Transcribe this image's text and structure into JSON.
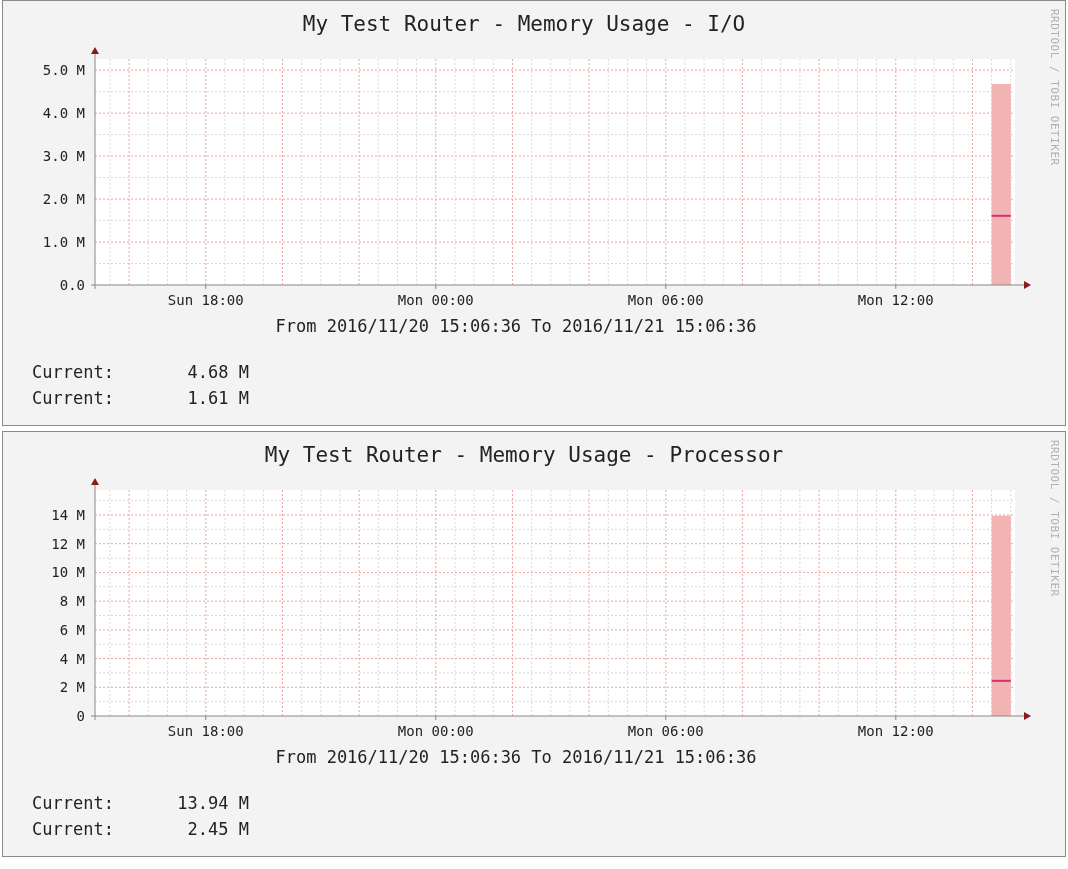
{
  "graphs": [
    {
      "title": "My Test Router - Memory Usage - I/O",
      "credit": "RRDTOOL / TOBI OETIKER",
      "chart_data": {
        "type": "area",
        "grid": true,
        "ylim": [
          0,
          5.26
        ],
        "categories": [
          null,
          null,
          null,
          null,
          null,
          "Sun 18:00",
          null,
          null,
          null,
          null,
          null,
          null,
          null,
          null,
          null,
          null,
          null,
          "Mon 00:00",
          null,
          null,
          null,
          null,
          null,
          null,
          null,
          null,
          null,
          null,
          null,
          "Mon 06:00",
          null,
          null,
          null,
          null,
          null,
          null,
          null,
          null,
          null,
          null,
          null,
          "Mon 12:00",
          null,
          null,
          null,
          null,
          null,
          null
        ],
        "yticks": [
          {
            "value": 0,
            "label": "0.0"
          },
          {
            "value": 1,
            "label": "1.0 M"
          },
          {
            "value": 2,
            "label": "2.0 M"
          },
          {
            "value": 3,
            "label": "3.0 M"
          },
          {
            "value": 4,
            "label": "4.0 M"
          },
          {
            "value": 5,
            "label": "5.0 M"
          }
        ],
        "series": [
          {
            "type": "area",
            "color": "#f2b3b3",
            "values": [
              null,
              null,
              null,
              null,
              null,
              null,
              null,
              null,
              null,
              null,
              null,
              null,
              null,
              null,
              null,
              null,
              null,
              null,
              null,
              null,
              null,
              null,
              null,
              null,
              null,
              null,
              null,
              null,
              null,
              null,
              null,
              null,
              null,
              null,
              null,
              null,
              null,
              null,
              null,
              null,
              null,
              null,
              null,
              null,
              null,
              null,
              4.68,
              4.68
            ]
          },
          {
            "type": "line",
            "color": "#d2336e",
            "values": [
              null,
              null,
              null,
              null,
              null,
              null,
              null,
              null,
              null,
              null,
              null,
              null,
              null,
              null,
              null,
              null,
              null,
              null,
              null,
              null,
              null,
              null,
              null,
              null,
              null,
              null,
              null,
              null,
              null,
              null,
              null,
              null,
              null,
              null,
              null,
              null,
              null,
              null,
              null,
              null,
              null,
              null,
              null,
              null,
              null,
              null,
              1.61,
              1.61
            ]
          }
        ]
      },
      "period": "From 2016/11/20 15:06:36 To 2016/11/21 15:06:36",
      "legend": [
        {
          "label": "Current:",
          "value": "4.68 M"
        },
        {
          "label": "Current:",
          "value": "1.61 M"
        }
      ]
    },
    {
      "title": "My Test Router - Memory Usage - Processor",
      "credit": "RRDTOOL / TOBI OETIKER",
      "chart_data": {
        "type": "area",
        "grid": true,
        "ylim": [
          0,
          15.74
        ],
        "categories": [
          null,
          null,
          null,
          null,
          null,
          "Sun 18:00",
          null,
          null,
          null,
          null,
          null,
          null,
          null,
          null,
          null,
          null,
          null,
          "Mon 00:00",
          null,
          null,
          null,
          null,
          null,
          null,
          null,
          null,
          null,
          null,
          null,
          "Mon 06:00",
          null,
          null,
          null,
          null,
          null,
          null,
          null,
          null,
          null,
          null,
          null,
          "Mon 12:00",
          null,
          null,
          null,
          null,
          null,
          null
        ],
        "yticks": [
          {
            "value": 0,
            "label": "0"
          },
          {
            "value": 2,
            "label": "2 M"
          },
          {
            "value": 4,
            "label": "4 M"
          },
          {
            "value": 6,
            "label": "6 M"
          },
          {
            "value": 8,
            "label": "8 M"
          },
          {
            "value": 10,
            "label": "10 M"
          },
          {
            "value": 12,
            "label": "12 M"
          },
          {
            "value": 14,
            "label": "14 M"
          }
        ],
        "series": [
          {
            "type": "area",
            "color": "#f2b3b3",
            "values": [
              null,
              null,
              null,
              null,
              null,
              null,
              null,
              null,
              null,
              null,
              null,
              null,
              null,
              null,
              null,
              null,
              null,
              null,
              null,
              null,
              null,
              null,
              null,
              null,
              null,
              null,
              null,
              null,
              null,
              null,
              null,
              null,
              null,
              null,
              null,
              null,
              null,
              null,
              null,
              null,
              null,
              null,
              null,
              null,
              null,
              null,
              13.94,
              13.94
            ]
          },
          {
            "type": "line",
            "color": "#d2336e",
            "values": [
              null,
              null,
              null,
              null,
              null,
              null,
              null,
              null,
              null,
              null,
              null,
              null,
              null,
              null,
              null,
              null,
              null,
              null,
              null,
              null,
              null,
              null,
              null,
              null,
              null,
              null,
              null,
              null,
              null,
              null,
              null,
              null,
              null,
              null,
              null,
              null,
              null,
              null,
              null,
              null,
              null,
              null,
              null,
              null,
              null,
              null,
              2.45,
              2.45
            ]
          }
        ]
      },
      "period": "From 2016/11/20 15:06:36 To 2016/11/21 15:06:36",
      "legend": [
        {
          "label": "Current:",
          "value": "13.94 M"
        },
        {
          "label": "Current:",
          "value": "2.45 M"
        }
      ]
    }
  ]
}
